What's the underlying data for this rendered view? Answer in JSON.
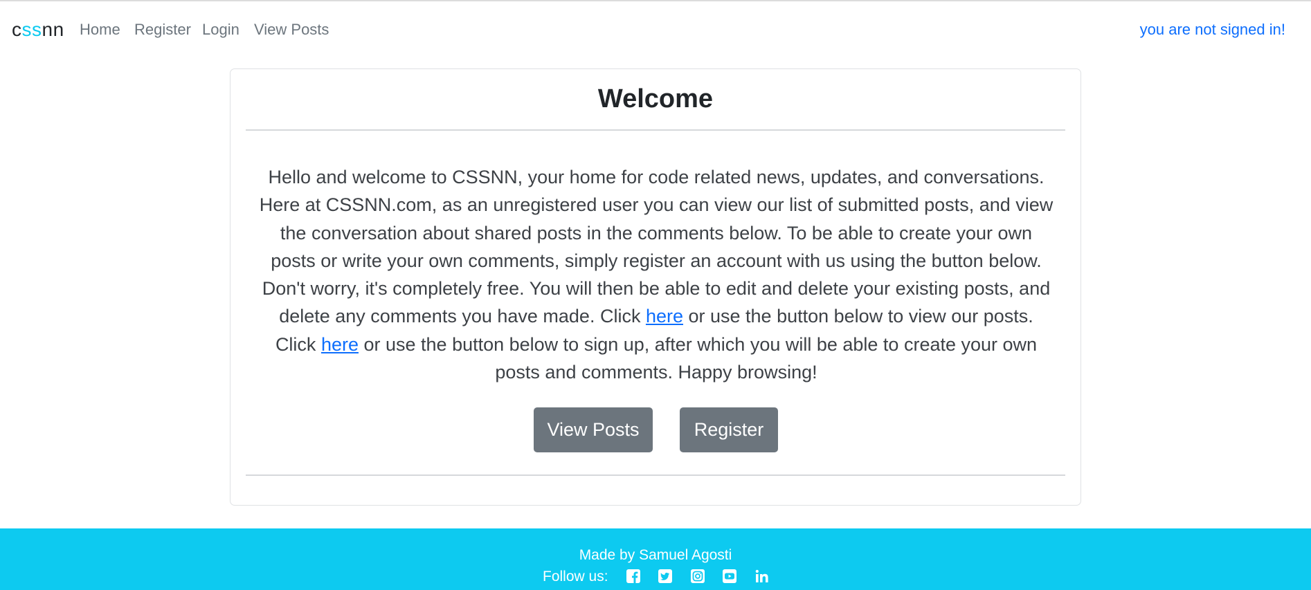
{
  "navbar": {
    "brand": {
      "part1": "c",
      "part2": "ss",
      "part3": "nn"
    },
    "links": [
      "Home",
      "Register",
      "Login",
      "View Posts"
    ],
    "status": "you are not signed in!"
  },
  "card": {
    "title": "Welcome",
    "text": {
      "p1": "Hello and welcome to CSSNN, your home for code related news, updates, and conversations. Here at CSSNN.com, as an unregistered user you can view our list of submitted posts, and view the conversation about shared posts in the comments below. To be able to create your own posts or write your own comments, simply register an account with us using the button below. Don't worry, it's completely free. You will then be able to edit and delete your existing posts, and delete any comments you have made. Click ",
      "link1": "here",
      "p2": " or use the button below to view our posts. Click ",
      "link2": "here",
      "p3": " or use the button below to sign up, after which you will be able to create your own posts and comments. Happy browsing!"
    },
    "buttons": {
      "view_posts": "View Posts",
      "register": "Register"
    }
  },
  "footer": {
    "made_by": "Made by Samuel Agosti",
    "follow_label": "Follow us:",
    "social_icons": [
      "facebook-icon",
      "twitter-icon",
      "instagram-icon",
      "youtube-icon",
      "linkedin-icon"
    ]
  },
  "colors": {
    "accent": "#0dcaf0",
    "link": "#0d6efd",
    "button": "#6c757d",
    "nav_text": "#6c757d"
  }
}
